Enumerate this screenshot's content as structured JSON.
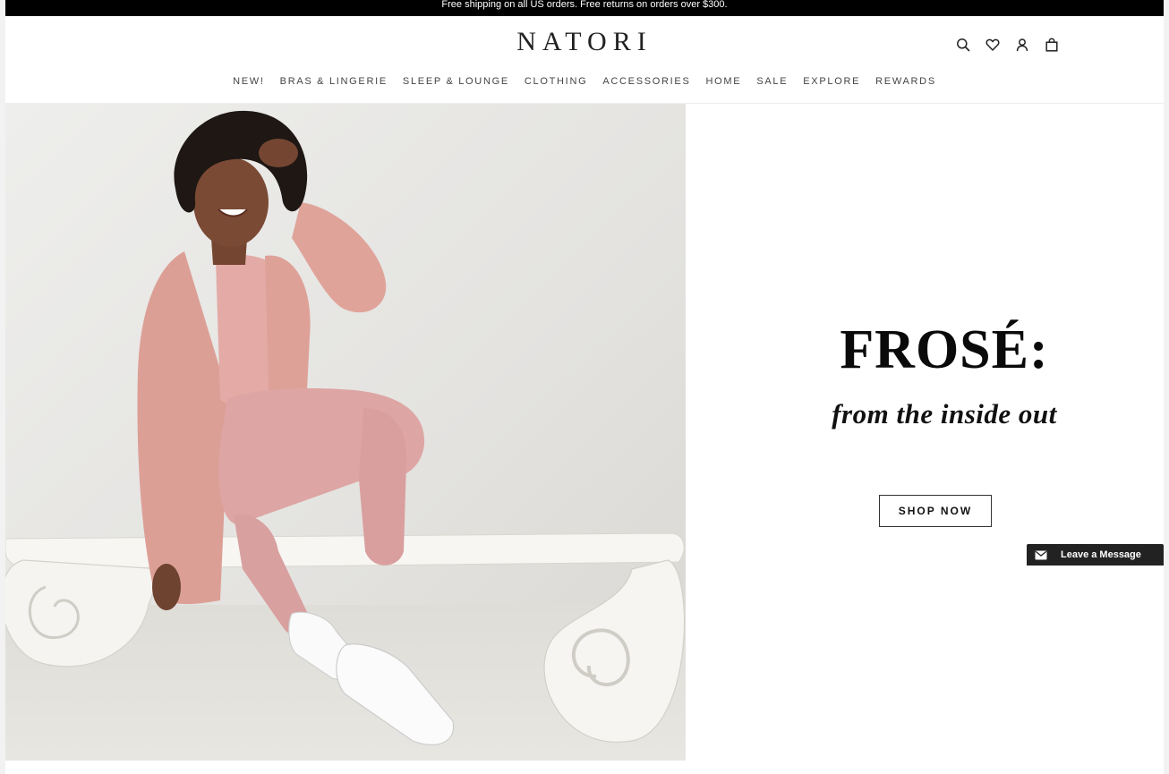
{
  "announcement": "Free shipping on all US orders. Free returns on orders over $300.",
  "brand": {
    "logo_text": "NATORI"
  },
  "header_icons": [
    "search-icon",
    "heart-icon",
    "user-icon",
    "bag-icon"
  ],
  "nav": {
    "items": [
      {
        "label": "NEW!"
      },
      {
        "label": "BRAS & LINGERIE"
      },
      {
        "label": "SLEEP & LOUNGE"
      },
      {
        "label": "CLOTHING"
      },
      {
        "label": "ACCESSORIES"
      },
      {
        "label": "HOME"
      },
      {
        "label": "SALE"
      },
      {
        "label": "EXPLORE"
      },
      {
        "label": "REWARDS"
      }
    ]
  },
  "hero": {
    "headline": "FROSÉ:",
    "subhead": "from the inside out",
    "cta_label": "SHOP NOW",
    "colors": {
      "cardigan": "#e0a39a",
      "leggings": "#dea5a4",
      "bench": "#f4f3ef",
      "backdrop": "#e6e5e2"
    }
  },
  "chat": {
    "label": "Leave a Message",
    "icon": "mail-icon"
  }
}
